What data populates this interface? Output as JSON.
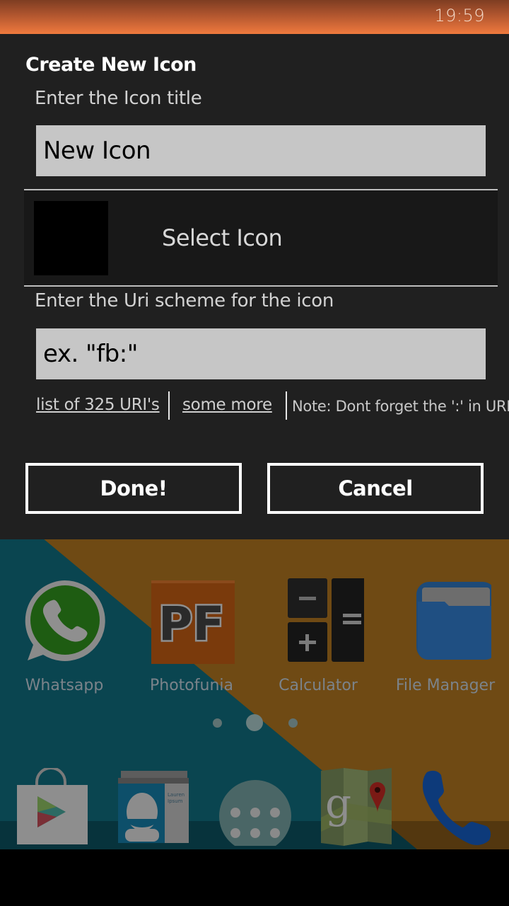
{
  "status_bar": {
    "time": "19:59"
  },
  "dialog": {
    "title": "Create New Icon",
    "title_field": {
      "label": "Enter the Icon title",
      "value": "New Icon"
    },
    "select_icon": {
      "label": "Select Icon"
    },
    "uri_field": {
      "label": "Enter the Uri scheme for the icon",
      "placeholder": "ex. \"fb:\"",
      "value": ""
    },
    "links": {
      "uri_list": "list of 325 URI's",
      "some_more": "some more",
      "note": "Note: Dont forget the ':' in URI"
    },
    "buttons": {
      "done": "Done!",
      "cancel": "Cancel"
    }
  },
  "home_screen": {
    "apps": [
      {
        "label": "Whatsapp",
        "icon": "whatsapp-icon"
      },
      {
        "label": "Photofunia",
        "icon": "photofunia-icon"
      },
      {
        "label": "Calculator",
        "icon": "calculator-icon"
      },
      {
        "label": "File Manager",
        "icon": "file-manager-icon"
      }
    ],
    "page_indicator": {
      "pages": 3,
      "current": 2
    },
    "dock": [
      {
        "icon": "play-store-icon"
      },
      {
        "icon": "contacts-icon",
        "card_text": "Lauren Ipsum"
      },
      {
        "icon": "app-drawer-icon"
      },
      {
        "icon": "maps-icon"
      },
      {
        "icon": "phone-icon"
      }
    ]
  },
  "colors": {
    "dialog_bg": "#202020",
    "input_bg": "#c6c6c6",
    "status_bar_accent": "#f07a3e",
    "wall_teal": "#0a4550",
    "wall_amber": "#6f4a14"
  }
}
